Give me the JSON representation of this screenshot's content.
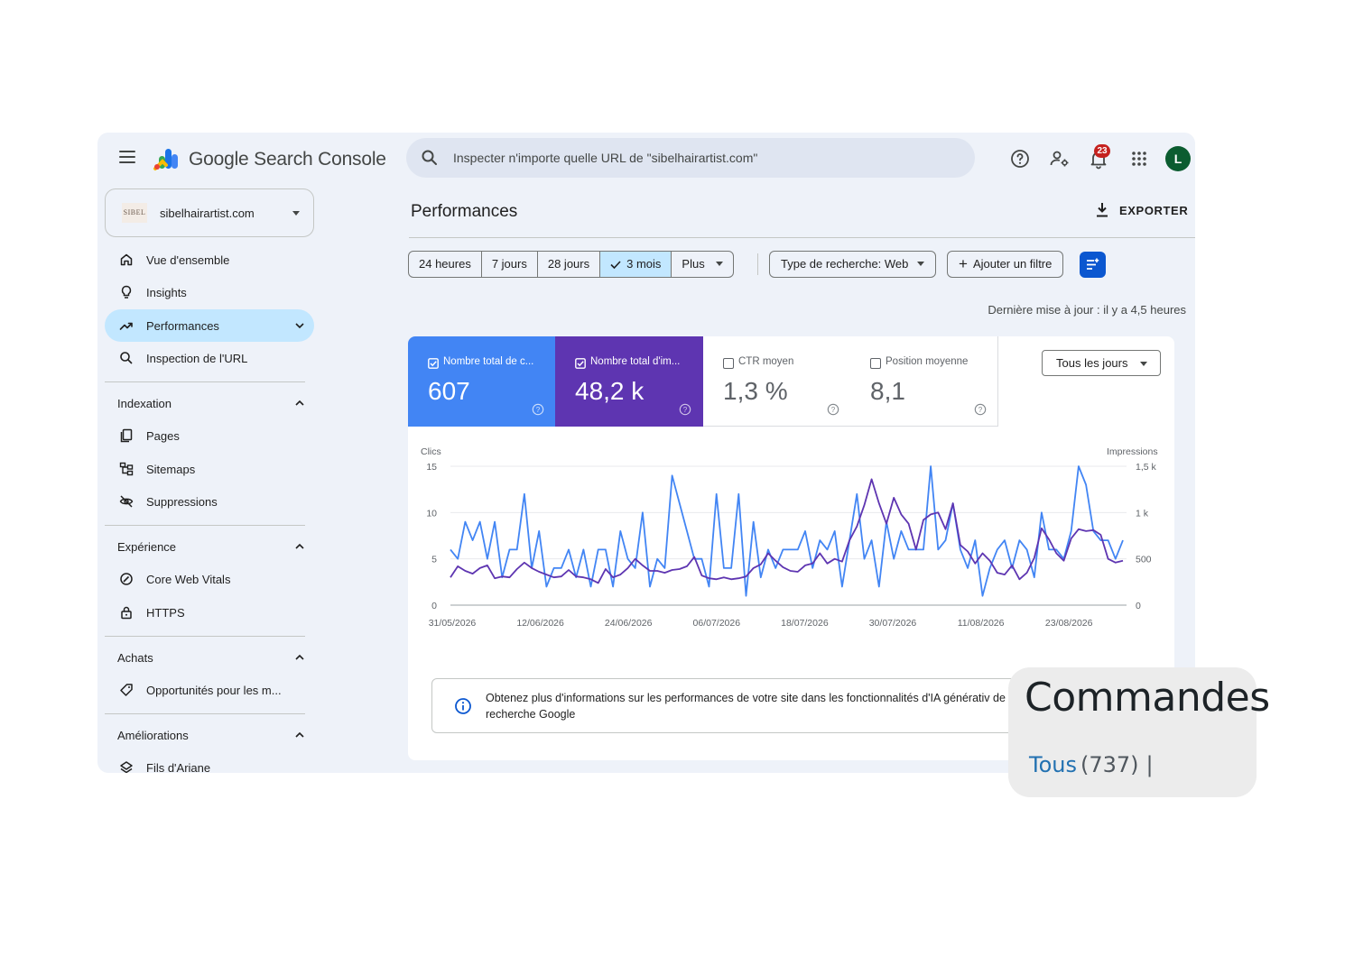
{
  "app": {
    "product_name": "Google Search Console",
    "search_placeholder": "Inspecter n'importe quelle URL de \"sibelhairartist.com\"",
    "notifications_count": "23",
    "avatar_initial": "L"
  },
  "property": {
    "name": "sibelhairartist.com",
    "thumb_text": "SIBEL"
  },
  "sidebar": {
    "top_items": [
      {
        "label": "Vue d'ensemble",
        "icon": "home-icon"
      },
      {
        "label": "Insights",
        "icon": "lightbulb-icon"
      },
      {
        "label": "Performances",
        "icon": "trending-up-icon",
        "active": true
      },
      {
        "label": "Inspection de l'URL",
        "icon": "search-icon"
      }
    ],
    "sections": [
      {
        "title": "Indexation",
        "items": [
          {
            "label": "Pages",
            "icon": "pages-icon"
          },
          {
            "label": "Sitemaps",
            "icon": "sitemap-icon"
          },
          {
            "label": "Suppressions",
            "icon": "eye-off-icon"
          }
        ]
      },
      {
        "title": "Expérience",
        "items": [
          {
            "label": "Core Web Vitals",
            "icon": "gauge-icon"
          },
          {
            "label": "HTTPS",
            "icon": "lock-icon"
          }
        ]
      },
      {
        "title": "Achats",
        "items": [
          {
            "label": "Opportunités pour les m...",
            "icon": "tag-icon"
          }
        ]
      },
      {
        "title": "Améliorations",
        "items": [
          {
            "label": "Fils d'Ariane",
            "icon": "layers-icon"
          }
        ]
      }
    ]
  },
  "main": {
    "title": "Performances",
    "export_label": "EXPORTER",
    "date_ranges": [
      "24 heures",
      "7 jours",
      "28 jours",
      "3 mois",
      "Plus"
    ],
    "selected_range": "3 mois",
    "search_type": "Type de recherche: Web",
    "add_filter": "Ajouter un filtre",
    "last_update": "Dernière mise à jour : il y a 4,5 heures"
  },
  "metrics": [
    {
      "label": "Nombre total de c...",
      "value": "607",
      "checked": true,
      "color": "#4285f4"
    },
    {
      "label": "Nombre total d'im...",
      "value": "48,2 k",
      "checked": true,
      "color": "#5e35b1"
    },
    {
      "label": "CTR moyen",
      "value": "1,3 %",
      "checked": false
    },
    {
      "label": "Position moyenne",
      "value": "8,1",
      "checked": false
    }
  ],
  "days_select": "Tous les jours",
  "chart_data": {
    "type": "line",
    "xlabel": "",
    "left_axis_title": "Clics",
    "right_axis_title": "Impressions",
    "y_left_ticks": [
      "15",
      "10",
      "5",
      "0"
    ],
    "y_right_ticks": [
      "1,5 k",
      "1 k",
      "500",
      "0"
    ],
    "ylim_left": [
      0,
      15
    ],
    "ylim_right": [
      0,
      1500
    ],
    "x_tick_labels": [
      "31/05/2026",
      "12/06/2026",
      "24/06/2026",
      "06/07/2026",
      "18/07/2026",
      "30/07/2026",
      "11/08/2026",
      "23/08/2026"
    ],
    "series": [
      {
        "name": "",
        "axis": "left",
        "color": "#4285f4",
        "values": [
          6,
          5,
          9,
          7,
          9,
          5,
          9,
          3,
          6,
          6,
          12,
          4,
          8,
          2,
          4,
          4,
          6,
          3,
          6,
          2,
          6,
          6,
          2,
          8,
          5,
          4,
          10,
          2,
          5,
          4,
          14,
          11,
          8,
          5,
          5,
          2,
          12,
          4,
          4,
          12,
          1,
          9,
          3,
          6,
          4,
          6,
          6,
          6,
          8,
          4,
          7,
          6,
          8,
          2,
          7,
          12,
          5,
          7,
          2,
          9,
          5,
          8,
          6,
          6,
          6,
          15,
          6,
          7,
          11,
          6,
          4,
          7,
          1,
          4,
          6,
          7,
          4,
          7,
          6,
          3,
          10,
          6,
          6,
          5,
          8,
          15,
          13,
          8,
          7,
          7,
          5,
          7
        ]
      },
      {
        "name": "",
        "axis": "right",
        "color": "#5e35b1",
        "values": [
          300,
          420,
          370,
          340,
          400,
          430,
          290,
          310,
          300,
          390,
          460,
          400,
          360,
          330,
          300,
          310,
          380,
          310,
          300,
          280,
          240,
          390,
          300,
          330,
          400,
          500,
          430,
          370,
          370,
          350,
          380,
          390,
          420,
          520,
          320,
          290,
          280,
          300,
          280,
          290,
          310,
          400,
          440,
          560,
          480,
          410,
          370,
          360,
          430,
          450,
          560,
          450,
          500,
          470,
          700,
          850,
          1080,
          1360,
          1100,
          880,
          1160,
          980,
          880,
          600,
          920,
          980,
          1000,
          820,
          1100,
          650,
          580,
          450,
          560,
          480,
          350,
          330,
          430,
          280,
          350,
          510,
          830,
          710,
          560,
          480,
          720,
          820,
          800,
          810,
          760,
          500,
          460,
          480
        ]
      }
    ]
  },
  "info": {
    "text": "Obtenez plus d'informations sur les performances de votre site dans les fonctionnalités d'IA générativ de la recherche Google"
  },
  "orders_widget": {
    "title": "Commandes",
    "filter_label": "Tous",
    "filter_count": "(737)",
    "separator": "|"
  }
}
